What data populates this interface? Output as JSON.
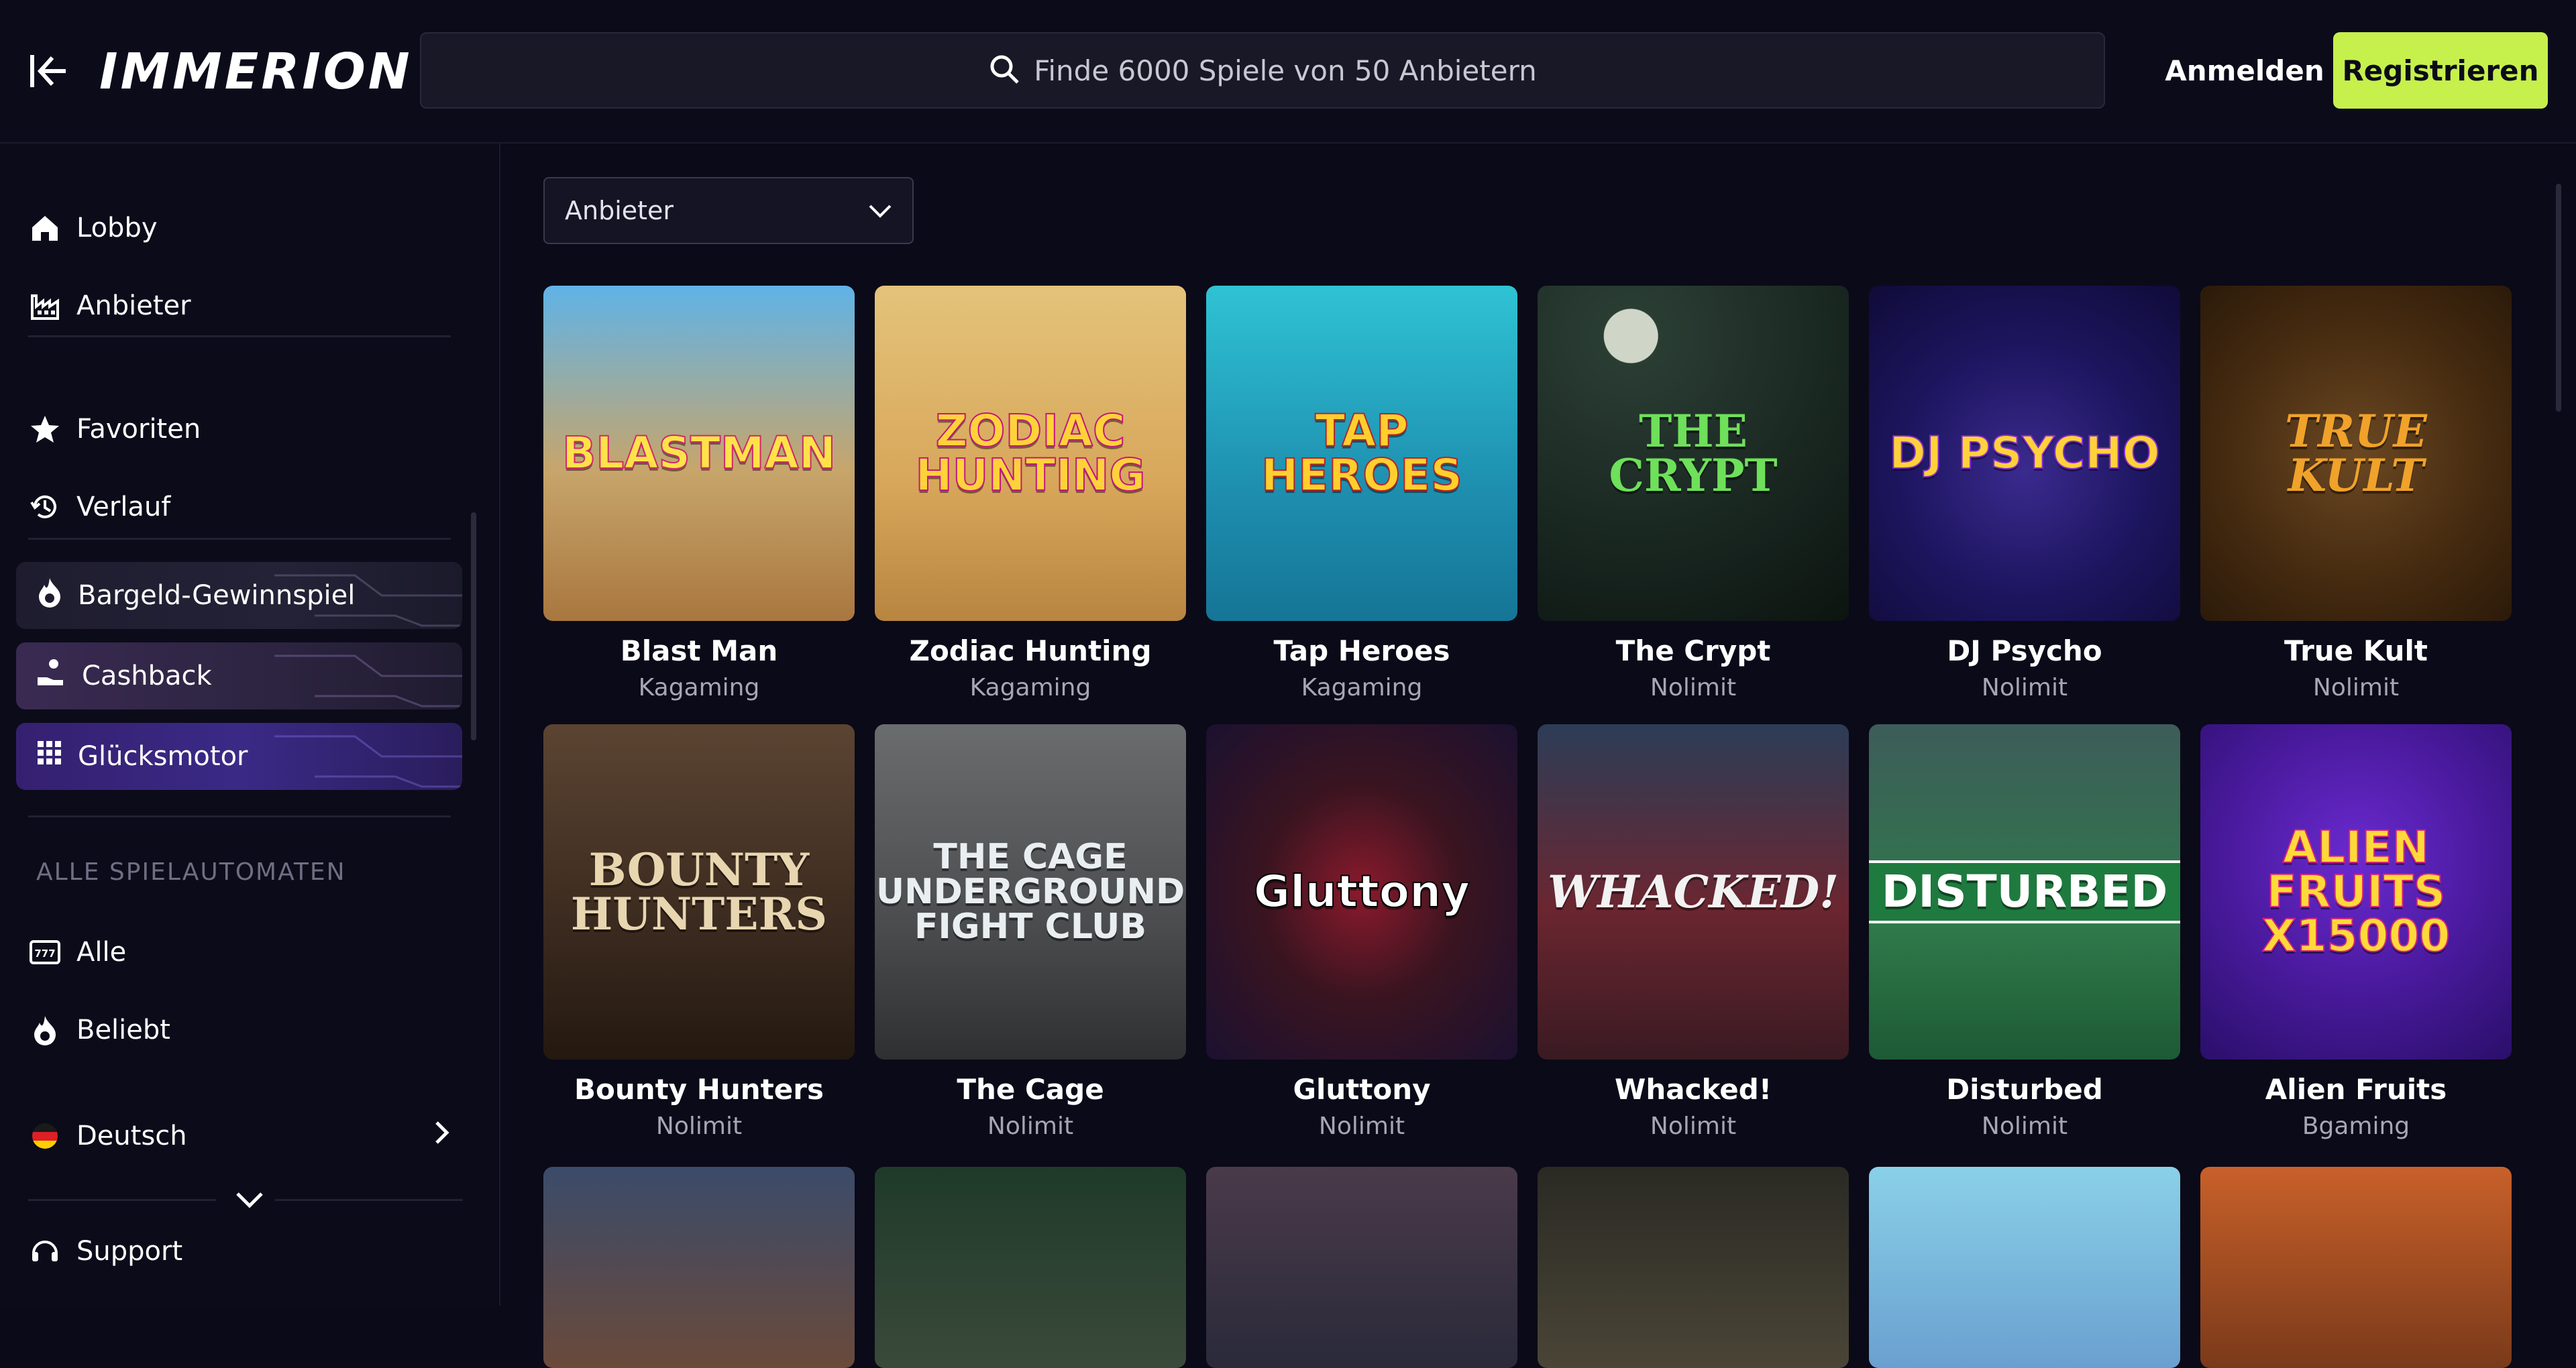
{
  "header": {
    "logo": "IMMERION",
    "search_placeholder": "Finde 6000 Spiele von 50 Anbietern",
    "login": "Anmelden",
    "register": "Registrieren"
  },
  "sidebar": {
    "nav": [
      {
        "label": "Lobby",
        "icon": "home-icon"
      },
      {
        "label": "Anbieter",
        "icon": "factory-icon"
      }
    ],
    "personal": [
      {
        "label": "Favoriten",
        "icon": "star-icon"
      },
      {
        "label": "Verlauf",
        "icon": "history-icon"
      }
    ],
    "promos": [
      {
        "label": "Bargeld-Gewinnspiel",
        "icon": "flame-icon"
      },
      {
        "label": "Cashback",
        "icon": "hand-coin-icon"
      },
      {
        "label": "Glücksmotor",
        "icon": "grid-icon"
      }
    ],
    "section_title": "ALLE SPIELAUTOMATEN",
    "slots": [
      {
        "label": "Alle",
        "icon": "slot-machine-icon"
      },
      {
        "label": "Beliebt",
        "icon": "flame-icon"
      }
    ],
    "language": {
      "label": "Deutsch",
      "icon": "germany-flag-icon"
    },
    "support": {
      "label": "Support",
      "icon": "headset-icon"
    }
  },
  "filter": {
    "label": "Anbieter"
  },
  "games": [
    {
      "title": "Blast Man",
      "provider": "Kagaming",
      "art": "BLASTMAN"
    },
    {
      "title": "Zodiac Hunting",
      "provider": "Kagaming",
      "art": "ZODIAC HUNTING"
    },
    {
      "title": "Tap Heroes",
      "provider": "Kagaming",
      "art": "TAP HEROES"
    },
    {
      "title": "The Crypt",
      "provider": "Nolimit",
      "art": "THE CRYPT"
    },
    {
      "title": "DJ Psycho",
      "provider": "Nolimit",
      "art": "DJ PSYCHO"
    },
    {
      "title": "True Kult",
      "provider": "Nolimit",
      "art": "TRUE KULT"
    },
    {
      "title": "Bounty Hunters",
      "provider": "Nolimit",
      "art": "BOUNTY HUNTERS"
    },
    {
      "title": "The Cage",
      "provider": "Nolimit",
      "art": "THE CAGE UNDERGROUND FIGHT CLUB"
    },
    {
      "title": "Gluttony",
      "provider": "Nolimit",
      "art": "Gluttony"
    },
    {
      "title": "Whacked!",
      "provider": "Nolimit",
      "art": "WHACKED!"
    },
    {
      "title": "Disturbed",
      "provider": "Nolimit",
      "art": "DISTURBED"
    },
    {
      "title": "Alien Fruits",
      "provider": "Bgaming",
      "art": "ALIEN FRUITS X15000"
    }
  ],
  "colors": {
    "accent": "#c6f04b",
    "background": "#0b0a18",
    "muted": "#a7a6b5"
  }
}
